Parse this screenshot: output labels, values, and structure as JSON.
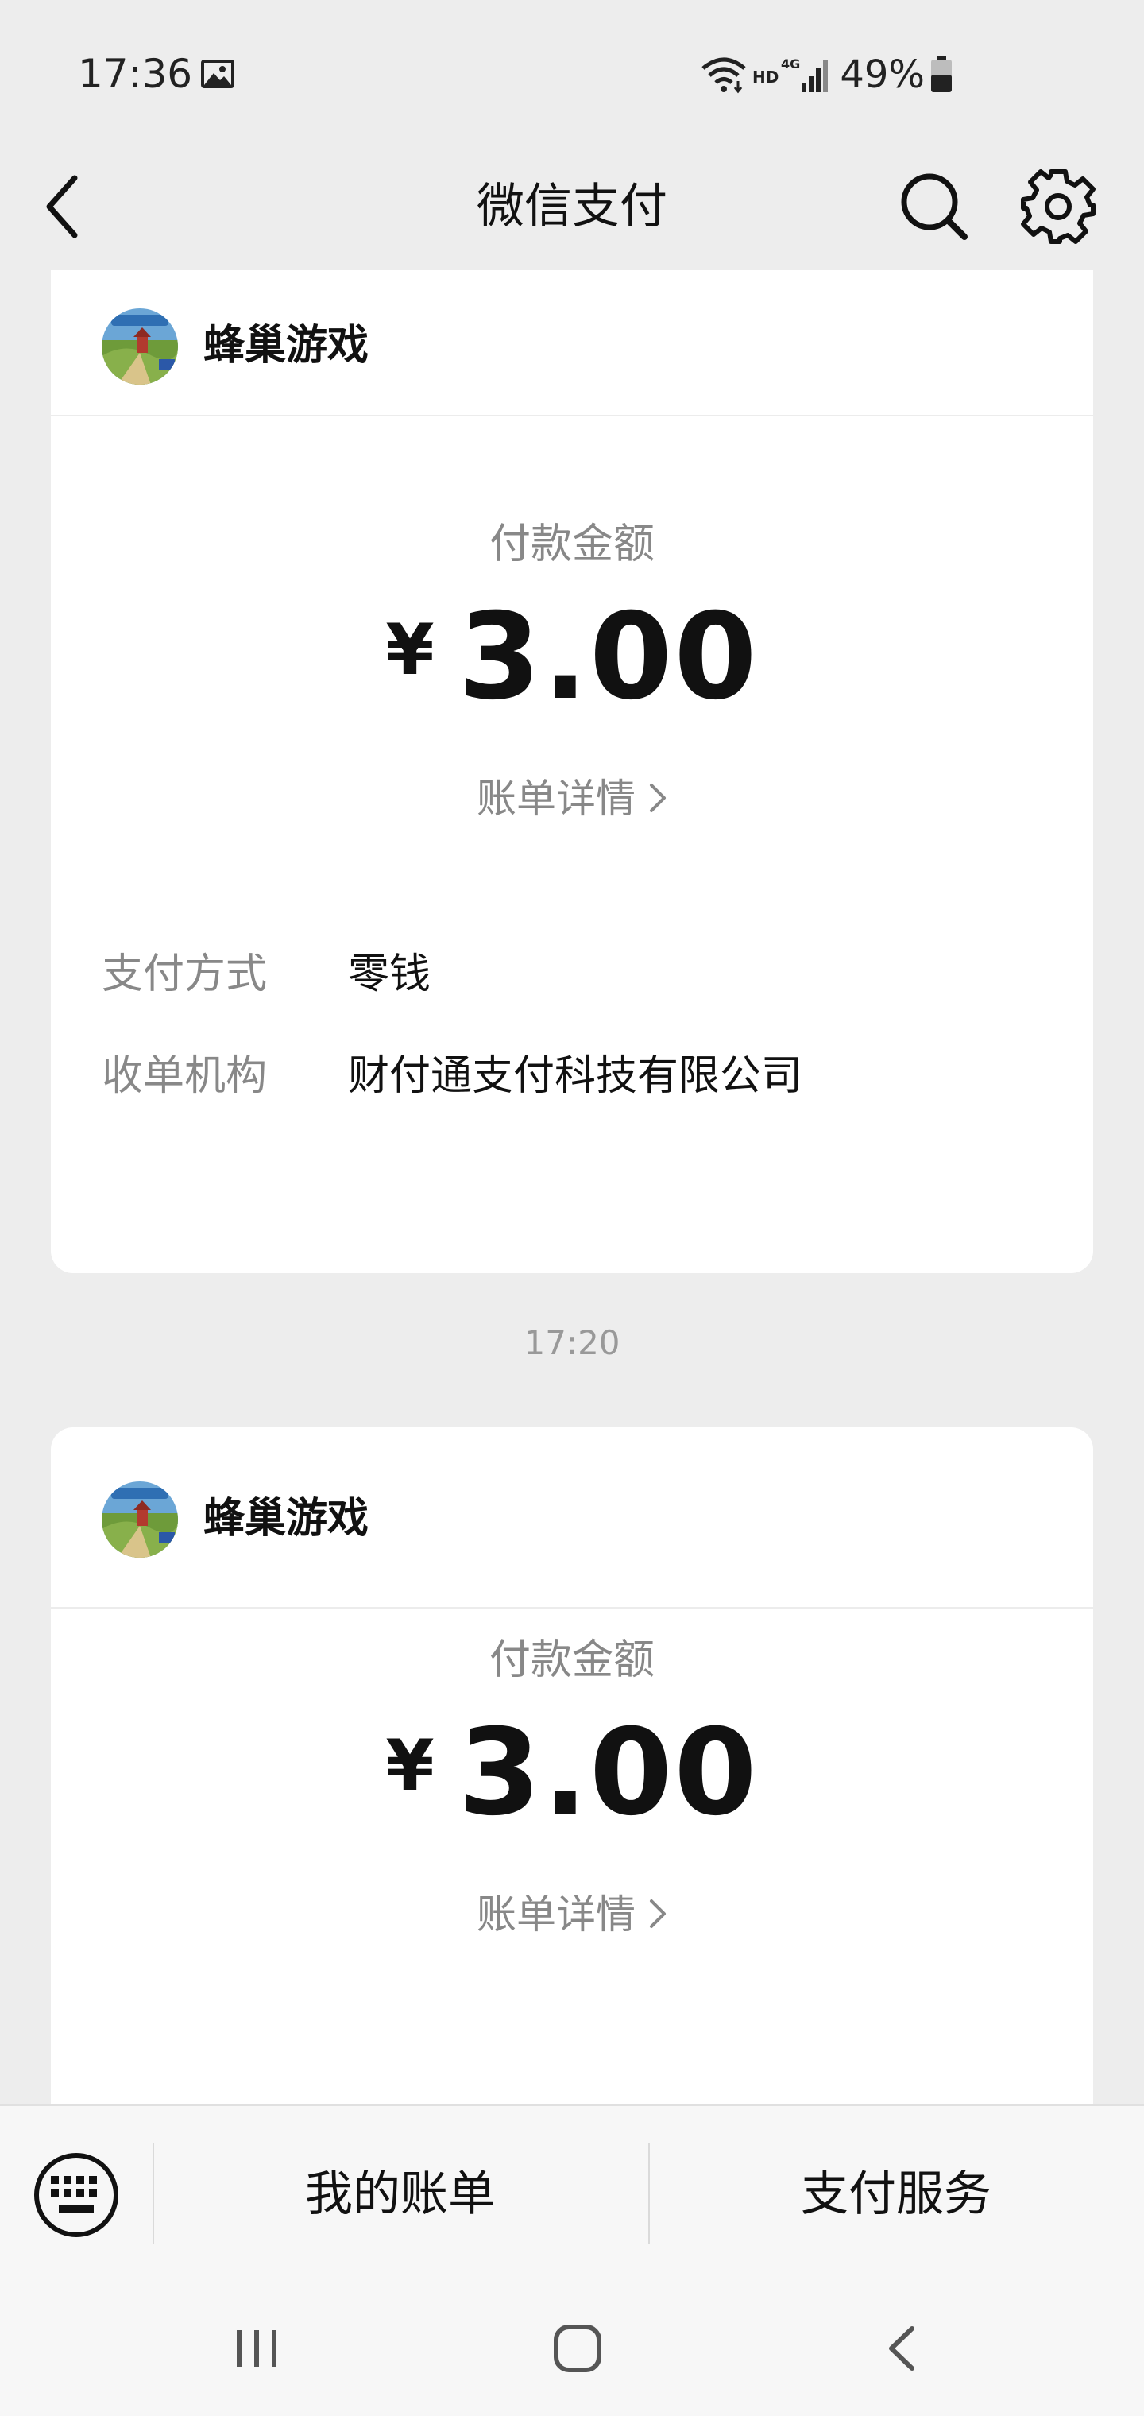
{
  "status_bar": {
    "time": "17:36",
    "battery": "49%",
    "icons": [
      "gallery-icon",
      "wifi-icon",
      "hd-4g-signal-icon",
      "battery-icon"
    ]
  },
  "nav": {
    "title": "微信支付",
    "icons": [
      "back-arrow-icon",
      "search-icon",
      "settings-gear-icon"
    ]
  },
  "payments": [
    {
      "merchant": "蜂巢游戏",
      "amount_label": "付款金额",
      "currency": "¥",
      "amount": "3.00",
      "detail_link": "账单详情",
      "method_label": "支付方式",
      "method_value": "零钱",
      "acquirer_label": "收单机构",
      "acquirer_value": "财付通支付科技有限公司"
    },
    {
      "time": "17:20",
      "merchant": "蜂巢游戏",
      "amount_label": "付款金额",
      "currency": "¥",
      "amount": "3.00",
      "detail_link": "账单详情"
    }
  ],
  "bottom_menu": {
    "keyboard_icon": "keyboard-icon",
    "items": [
      "我的账单",
      "支付服务"
    ]
  },
  "system_nav": {
    "icons": [
      "recents-icon",
      "home-icon",
      "back-icon"
    ]
  },
  "colors": {
    "background": "#EDEDED",
    "card": "#FFFFFF",
    "secondary_text": "#888888",
    "primary_text": "#111111"
  }
}
